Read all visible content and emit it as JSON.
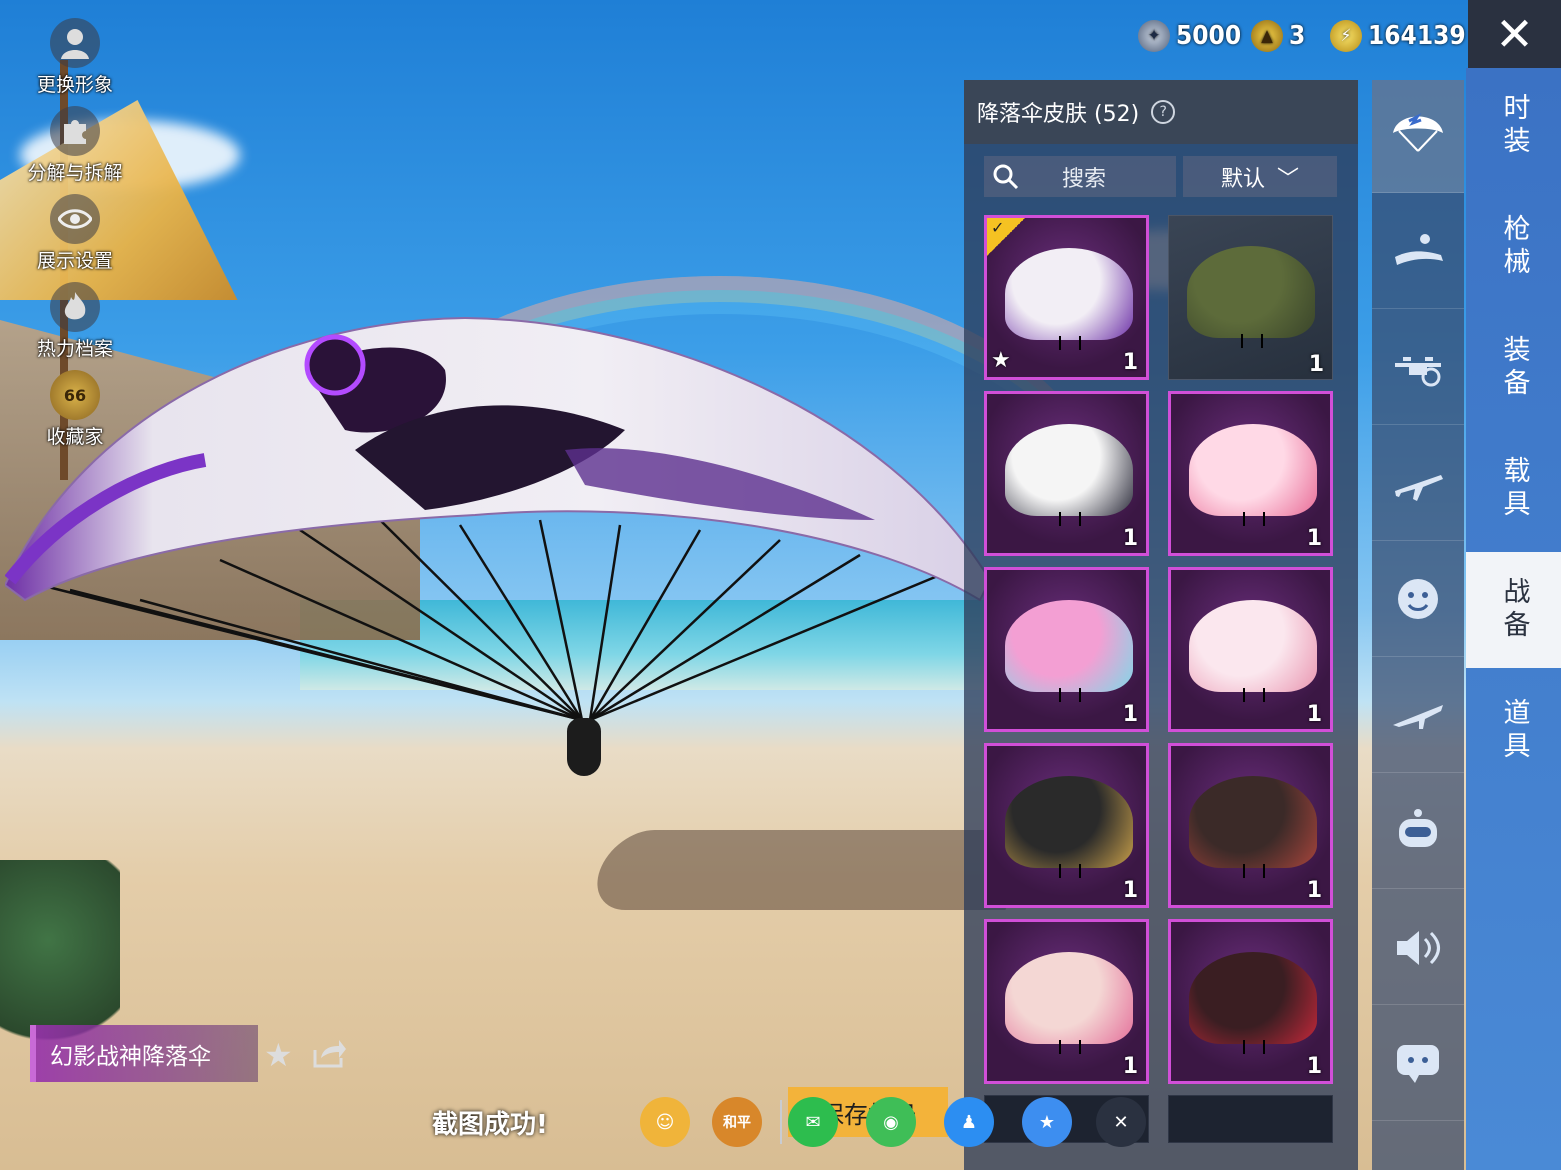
{
  "left_menu": [
    {
      "label": "更换形象",
      "icon": "avatar-icon"
    },
    {
      "label": "分解与拆解",
      "icon": "puzzle-icon"
    },
    {
      "label": "展示设置",
      "icon": "eye-icon"
    },
    {
      "label": "热力档案",
      "icon": "flame-icon"
    },
    {
      "label": "收藏家",
      "icon": "collector-badge-icon",
      "badge": "66"
    }
  ],
  "currencies": [
    {
      "value": "5000",
      "icon": "silver-coin-icon",
      "symbol": "✦"
    },
    {
      "value": "3",
      "icon": "gold-coin-icon",
      "symbol": "▲"
    },
    {
      "value": "164139",
      "icon": "lightning-coin-icon",
      "symbol": "⚡"
    }
  ],
  "close_symbol": "✕",
  "panel": {
    "title": "降落伞皮肤 (52)",
    "help_symbol": "?",
    "search_placeholder": "搜索",
    "sort_label": "默认",
    "sort_arrow": "﹀"
  },
  "items": [
    {
      "count": "1",
      "style": "purple",
      "equipped": true,
      "favorite": true,
      "canopy_colors": [
        "#f2eef5",
        "#6b2fa6"
      ]
    },
    {
      "count": "1",
      "style": "gray",
      "equipped": false,
      "favorite": false,
      "canopy_colors": [
        "#5d6b3a",
        "#39442a"
      ]
    },
    {
      "count": "1",
      "style": "purple",
      "equipped": false,
      "favorite": false,
      "canopy_colors": [
        "#f5f5f5",
        "#2b2b3a"
      ]
    },
    {
      "count": "1",
      "style": "purple",
      "equipped": false,
      "favorite": false,
      "canopy_colors": [
        "#ffd9e6",
        "#e86b96"
      ]
    },
    {
      "count": "1",
      "style": "purple",
      "equipped": false,
      "favorite": false,
      "canopy_colors": [
        "#f39fd3",
        "#7fd8e8"
      ]
    },
    {
      "count": "1",
      "style": "purple",
      "equipped": false,
      "favorite": false,
      "canopy_colors": [
        "#fbe7ee",
        "#e995b0"
      ]
    },
    {
      "count": "1",
      "style": "purple",
      "equipped": false,
      "favorite": false,
      "canopy_colors": [
        "#2a2a2a",
        "#c9a04a"
      ]
    },
    {
      "count": "1",
      "style": "purple",
      "equipped": false,
      "favorite": false,
      "canopy_colors": [
        "#3b2a28",
        "#a8453c"
      ]
    },
    {
      "count": "1",
      "style": "purple",
      "equipped": false,
      "favorite": false,
      "canopy_colors": [
        "#f4d7d4",
        "#e46f9a"
      ]
    },
    {
      "count": "1",
      "style": "purple",
      "equipped": false,
      "favorite": false,
      "canopy_colors": [
        "#3a1e22",
        "#c4283a"
      ]
    },
    {
      "count": "",
      "style": "dark",
      "equipped": false,
      "favorite": false,
      "canopy_colors": []
    },
    {
      "count": "",
      "style": "dark",
      "equipped": false,
      "favorite": false,
      "canopy_colors": []
    }
  ],
  "side_icons": [
    {
      "name": "parachute-icon",
      "active": true
    },
    {
      "name": "skydiver-icon",
      "active": false
    },
    {
      "name": "drone-icon",
      "active": false
    },
    {
      "name": "airplane-icon",
      "active": false
    },
    {
      "name": "emote-face-icon",
      "active": false
    },
    {
      "name": "plane-trail-icon",
      "active": false
    },
    {
      "name": "robot-icon",
      "active": false
    },
    {
      "name": "speaker-icon",
      "active": false
    },
    {
      "name": "chat-bubble-icon",
      "active": false
    }
  ],
  "tabs": [
    {
      "label": "时装",
      "active": false
    },
    {
      "label": "枪械",
      "active": false
    },
    {
      "label": "装备",
      "active": false
    },
    {
      "label": "载具",
      "active": false
    },
    {
      "label": "战备",
      "active": true
    },
    {
      "label": "道具",
      "active": false
    }
  ],
  "selected_item_name": "幻影战神降落伞",
  "favorite_symbol": "★",
  "toast": "截图成功!",
  "save_button_label": "保存相册",
  "share_targets": [
    {
      "name": "share-friends-icon",
      "symbol": "☺",
      "color": "#f0b43a"
    },
    {
      "name": "share-game-icon",
      "symbol": "和平",
      "color": "#d8872a"
    },
    {
      "name": "share-wechat-icon",
      "symbol": "✉",
      "color": "#2dbd4e"
    },
    {
      "name": "share-moments-icon",
      "symbol": "◉",
      "color": "#3fbe57"
    },
    {
      "name": "share-qq-icon",
      "symbol": "♟",
      "color": "#2c8ef2"
    },
    {
      "name": "share-qzone-icon",
      "symbol": "★",
      "color": "#3d8ef0"
    },
    {
      "name": "share-close-icon",
      "symbol": "✕",
      "color": "#2a3140"
    }
  ],
  "colors": {
    "accent_purple": "#d14fd8",
    "tab_blue": "#4a8ad6",
    "panel_bg": "#2d3c5a",
    "gold": "#f3b33a"
  }
}
